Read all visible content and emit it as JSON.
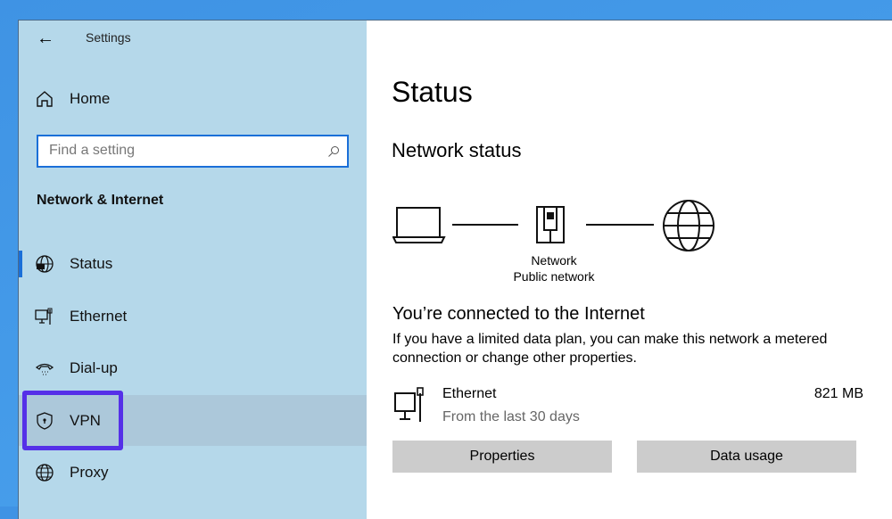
{
  "window": {
    "title": "Settings"
  },
  "sidebar": {
    "home": "Home",
    "search_placeholder": "Find a setting",
    "section": "Network & Internet",
    "items": [
      {
        "label": "Status"
      },
      {
        "label": "Ethernet"
      },
      {
        "label": "Dial-up"
      },
      {
        "label": "VPN"
      },
      {
        "label": "Proxy"
      }
    ]
  },
  "main": {
    "title": "Status",
    "network_status": "Network status",
    "network_name": "Network",
    "network_type": "Public network",
    "connected": "You’re connected to the Internet",
    "description": "If you have a limited data plan, you can make this network a metered connection or change other properties.",
    "adapter": {
      "name": "Ethernet",
      "period": "From the last 30 days",
      "usage": "821 MB"
    },
    "buttons": {
      "properties": "Properties",
      "data_usage": "Data usage"
    }
  },
  "colors": {
    "accent": "#1a6fd8",
    "highlight": "#5530e8"
  }
}
